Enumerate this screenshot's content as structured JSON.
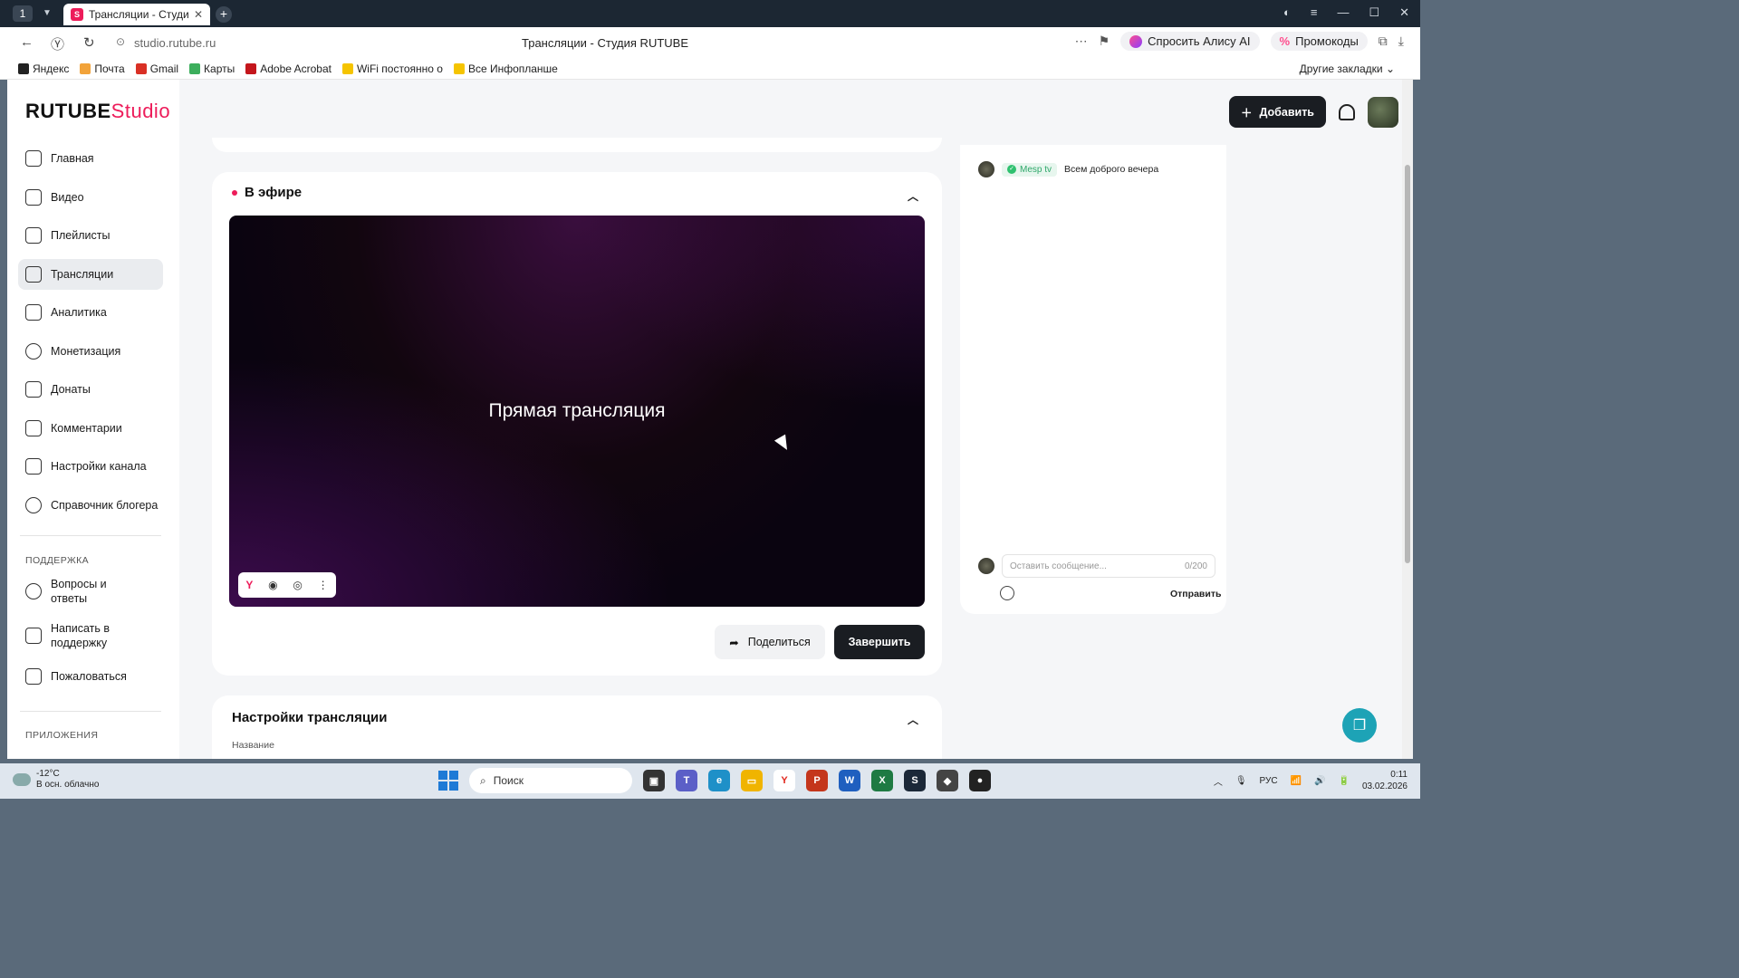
{
  "browser": {
    "tab_counter": "1",
    "tab_title": "Трансляции - Студия R",
    "url": "studio.rutube.ru",
    "page_title": "Трансляции - Студия RUTUBE",
    "alice_label": "Спросить Алису AI",
    "promo_label": "Промокоды",
    "bookmarks": [
      {
        "label": "Яндекс",
        "color": "#222222"
      },
      {
        "label": "Почта",
        "color": "#f2a33a"
      },
      {
        "label": "Gmail",
        "color": "#d93025"
      },
      {
        "label": "Карты",
        "color": "#3cae5c"
      },
      {
        "label": "Adobe Acrobat",
        "color": "#c4161c"
      },
      {
        "label": "WiFi постоянно о",
        "color": "#f5c400"
      },
      {
        "label": "Все Инфопланше",
        "color": "#f5c400"
      }
    ],
    "other_bookmarks": "Другие закладки"
  },
  "app": {
    "logo_main": "RUTUBE",
    "logo_studio": "Studio",
    "add_label": "Добавить",
    "accent": "#ed1c5a"
  },
  "sidebar": {
    "items": [
      {
        "label": "Главная",
        "icon": "home-icon"
      },
      {
        "label": "Видео",
        "icon": "video-icon"
      },
      {
        "label": "Плейлисты",
        "icon": "playlist-icon"
      },
      {
        "label": "Трансляции",
        "icon": "broadcast-icon",
        "active": true
      },
      {
        "label": "Аналитика",
        "icon": "chart-icon"
      },
      {
        "label": "Монетизация",
        "icon": "ruble-icon"
      },
      {
        "label": "Донаты",
        "icon": "wallet-icon"
      },
      {
        "label": "Комментарии",
        "icon": "comment-icon"
      },
      {
        "label": "Настройки канала",
        "icon": "gear-icon"
      },
      {
        "label": "Справочник блогера",
        "icon": "info-icon"
      }
    ],
    "support_label": "ПОДДЕРЖКА",
    "support_items": [
      {
        "label": "Вопросы и ответы",
        "icon": "question-icon"
      },
      {
        "label": "Написать в поддержку",
        "icon": "mail-icon"
      },
      {
        "label": "Пожаловаться",
        "icon": "flag-icon"
      }
    ],
    "apps_label": "ПРИЛОЖЕНИЯ"
  },
  "live": {
    "header": "В эфире",
    "player_title": "Прямая трансляция",
    "share_label": "Поделиться",
    "end_label": "Завершить"
  },
  "settings": {
    "title": "Настройки трансляции",
    "field_label": "Название"
  },
  "chat": {
    "messages": [
      {
        "author": "Mesp tv",
        "text": "Всем доброго вечера"
      }
    ],
    "placeholder": "Оставить сообщение...",
    "counter": "0/200",
    "send_label": "Отправить"
  },
  "taskbar": {
    "temp": "-12°C",
    "weather": "В осн. облачно",
    "search": "Поиск",
    "lang": "РУС",
    "time": "0:11",
    "date": "03.02.2026"
  }
}
